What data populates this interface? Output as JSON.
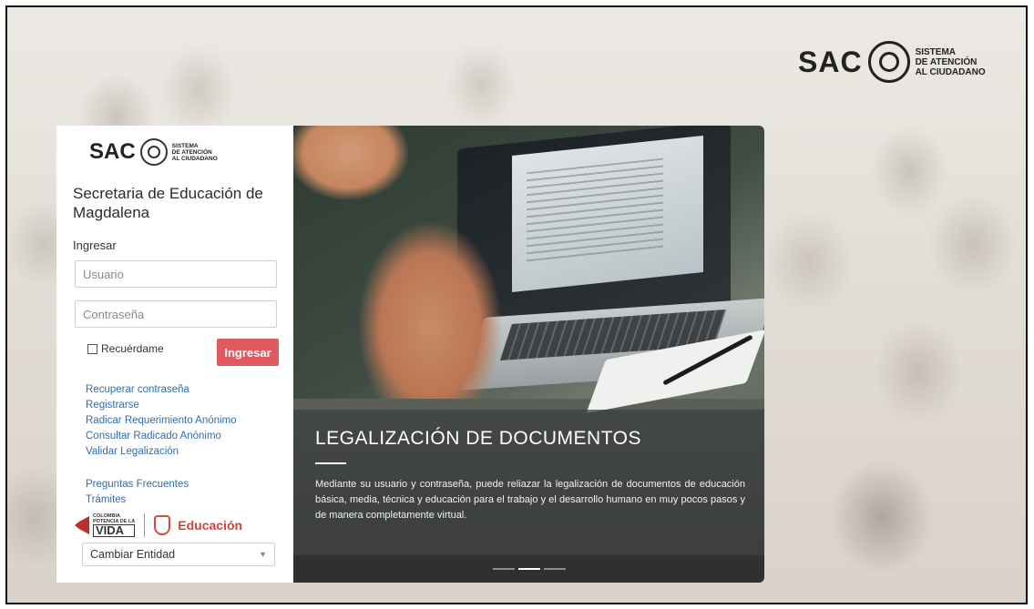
{
  "brand": {
    "sac": "SAC",
    "tagline": [
      "SISTEMA",
      "DE ATENCIÓN",
      "AL CIUDADANO"
    ]
  },
  "login": {
    "organization": "Secretaria de Educación de Magdalena",
    "section_label": "Ingresar",
    "username_placeholder": "Usuario",
    "password_placeholder": "Contraseña",
    "remember_label": "Recuérdame",
    "remember_checked": false,
    "submit_label": "Ingresar",
    "submit_color": "#e05a5f",
    "links": [
      "Recuperar contraseña",
      "Registrarse",
      "Radicar Requerimiento Anónimo",
      "Consultar Radicado Anónimo",
      "Validar Legalización"
    ],
    "links_secondary": [
      "Preguntas Frecuentes",
      "Trámites"
    ],
    "partner_colombia": [
      "COLOMBIA",
      "POTENCIA DE LA"
    ],
    "partner_vida": "VIDA",
    "partner_education": "Educación",
    "entity_select": "Cambiar Entidad"
  },
  "carousel": {
    "title": "LEGALIZACIÓN DE DOCUMENTOS",
    "description": "Mediante su usuario y contraseña, puede reliazar la legalización de documentos de educación básica, media, técnica y educación para el trabajo y el desarrollo humano en muy pocos pasos y de manera completamente virtual.",
    "slide_count": 3,
    "active_slide": 2
  }
}
